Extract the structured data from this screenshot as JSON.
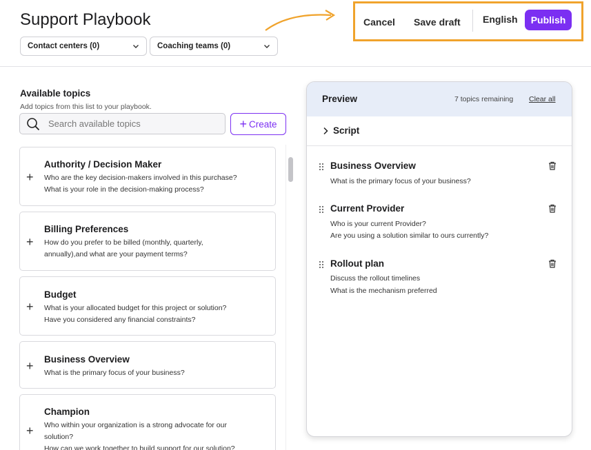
{
  "header": {
    "title": "Support Playbook",
    "contact_centers": "Contact centers (0)",
    "coaching_teams": "Coaching teams (0)"
  },
  "toolbar": {
    "cancel": "Cancel",
    "save_draft": "Save draft",
    "language": "English",
    "publish": "Publish",
    "highlight_color": "#f0a32c",
    "accent_color": "#7b2ff2"
  },
  "available": {
    "title": "Available topics",
    "subtitle": "Add topics from this list to your playbook.",
    "search_placeholder": "Search available topics",
    "create_label": "Create",
    "topics": [
      {
        "title": "Authority / Decision Maker",
        "questions": [
          "Who are the key decision-makers involved in this purchase?",
          "What is your role in the decision-making process?"
        ]
      },
      {
        "title": "Billing Preferences",
        "questions": [
          "How do you prefer to be billed (monthly, quarterly,",
          "annually),and what are your payment terms?"
        ]
      },
      {
        "title": "Budget",
        "questions": [
          "What is your allocated budget for this project or solution?",
          "Have you considered any financial constraints?"
        ]
      },
      {
        "title": "Business Overview",
        "questions": [
          "What is the primary focus of your business?"
        ]
      },
      {
        "title": "Champion",
        "questions": [
          "Who within your organization is a strong advocate for our",
          "solution?",
          "How can we work together to build support for our solution?"
        ]
      }
    ]
  },
  "preview": {
    "title": "Preview",
    "remaining": "7 topics remaining",
    "clear_all": "Clear all",
    "script_label": "Script",
    "items": [
      {
        "title": "Business Overview",
        "questions": [
          "What is the primary focus of your business?"
        ]
      },
      {
        "title": "Current Provider",
        "questions": [
          "Who is your current Provider?",
          "Are you using a solution similar to ours currently?"
        ]
      },
      {
        "title": "Rollout plan",
        "questions": [
          "Discuss the rollout timelines",
          "What is the mechanism preferred"
        ]
      }
    ]
  }
}
